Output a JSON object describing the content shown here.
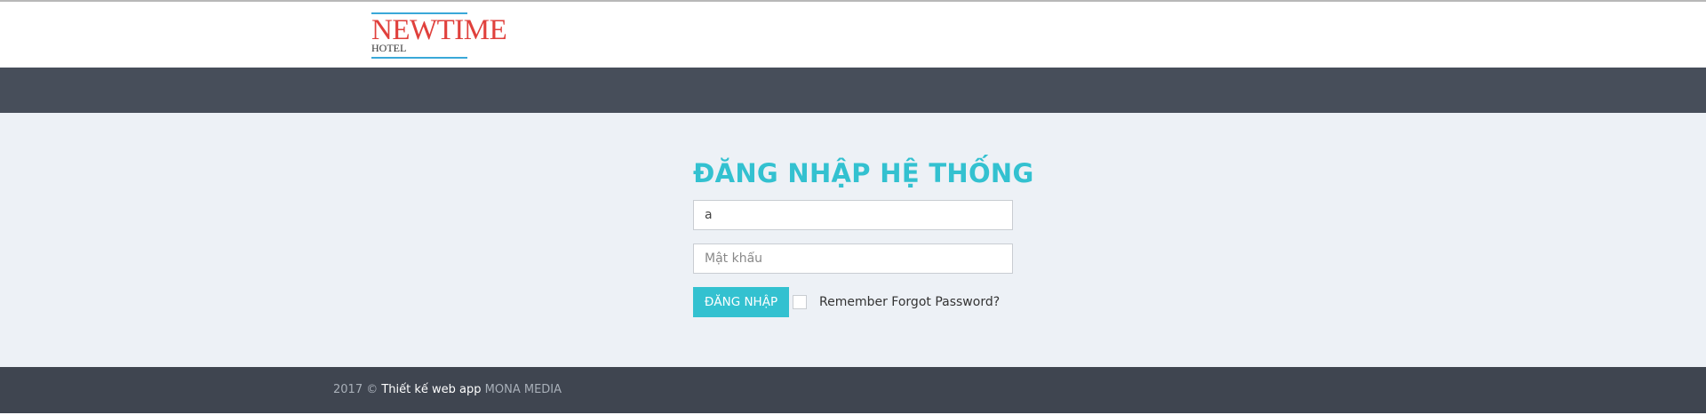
{
  "header": {
    "logo": {
      "name": "NEWTIME",
      "subtitle": "HOTEL"
    }
  },
  "login": {
    "title": "ĐĂNG NHẬP HỆ THỐNG",
    "username": {
      "value": "a"
    },
    "password": {
      "placeholder": "Mật khẩu"
    },
    "submit_label": "ĐĂNG NHẬP",
    "remember_text": "Remember Forgot Password?"
  },
  "footer": {
    "year": "2017 ©",
    "design": "Thiết kế web app",
    "brand": "MONA MEDIA"
  },
  "colors": {
    "accent": "#33c1d0",
    "logo_red": "#e0403c",
    "navbar": "#474e5a",
    "footer": "#3f4550",
    "background": "#edf1f6"
  }
}
